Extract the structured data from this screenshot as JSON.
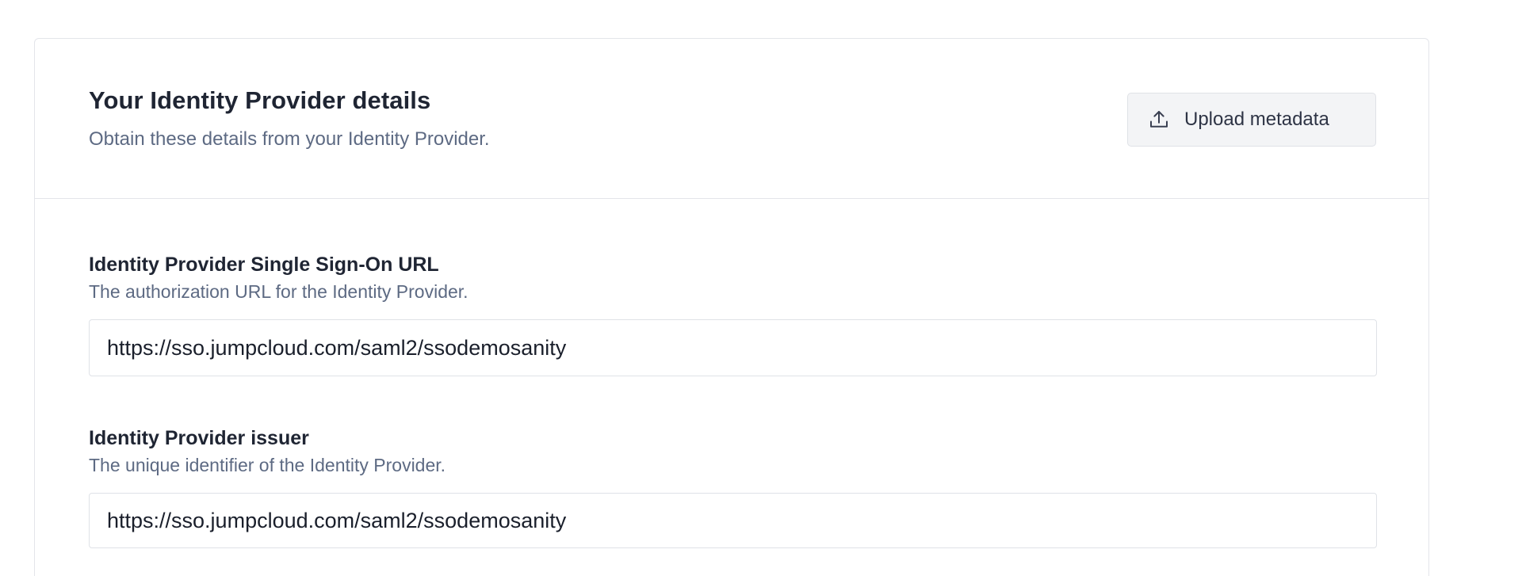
{
  "idp_card": {
    "title": "Your Identity Provider details",
    "subtitle": "Obtain these details from your Identity Provider.",
    "upload_button": {
      "label": "Upload metadata",
      "icon": "upload-icon"
    }
  },
  "fields": {
    "sso_url": {
      "label": "Identity Provider Single Sign-On URL",
      "help": "The authorization URL for the Identity Provider.",
      "value": "https://sso.jumpcloud.com/saml2/ssodemosanity"
    },
    "issuer": {
      "label": "Identity Provider issuer",
      "help": "The unique identifier of the Identity Provider.",
      "value": "https://sso.jumpcloud.com/saml2/ssodemosanity"
    }
  },
  "colors": {
    "border": "#e3e5ea",
    "heading": "#1f2533",
    "muted": "#5d6a83",
    "button_bg": "#f3f4f6"
  }
}
